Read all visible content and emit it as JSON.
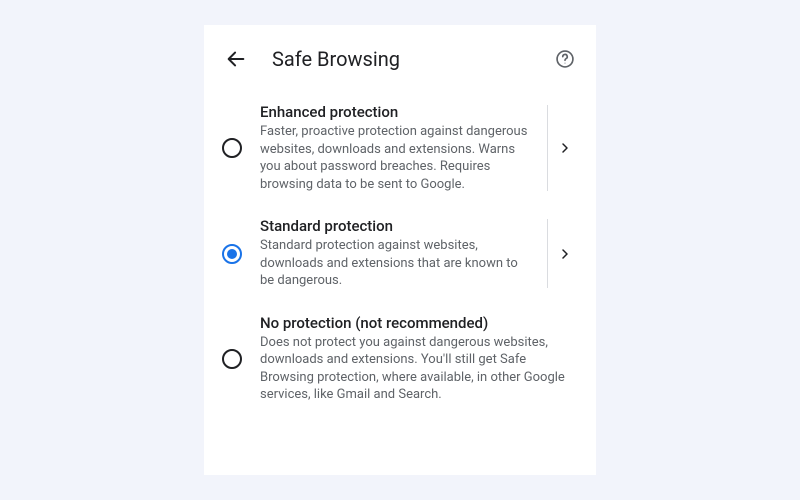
{
  "header": {
    "title": "Safe Browsing"
  },
  "options": [
    {
      "title": "Enhanced protection",
      "description": "Faster, proactive protection against dangerous websites, downloads and extensions. Warns you about password breaches. Requires browsing data to be sent to Google.",
      "selected": false,
      "has_detail": true
    },
    {
      "title": "Standard protection",
      "description": "Standard protection against websites, downloads and extensions that are known to be dangerous.",
      "selected": true,
      "has_detail": true
    },
    {
      "title": "No protection (not recommended)",
      "description": "Does not protect you against dangerous websites, downloads and extensions. You'll still get Safe Browsing protection, where available, in other Google services, like Gmail and Search.",
      "selected": false,
      "has_detail": false
    }
  ],
  "colors": {
    "accent": "#1a73e8",
    "text_primary": "#202124",
    "text_secondary": "#5f6368",
    "divider": "#dadce0",
    "page_bg": "#f2f4fb",
    "card_bg": "#ffffff"
  }
}
